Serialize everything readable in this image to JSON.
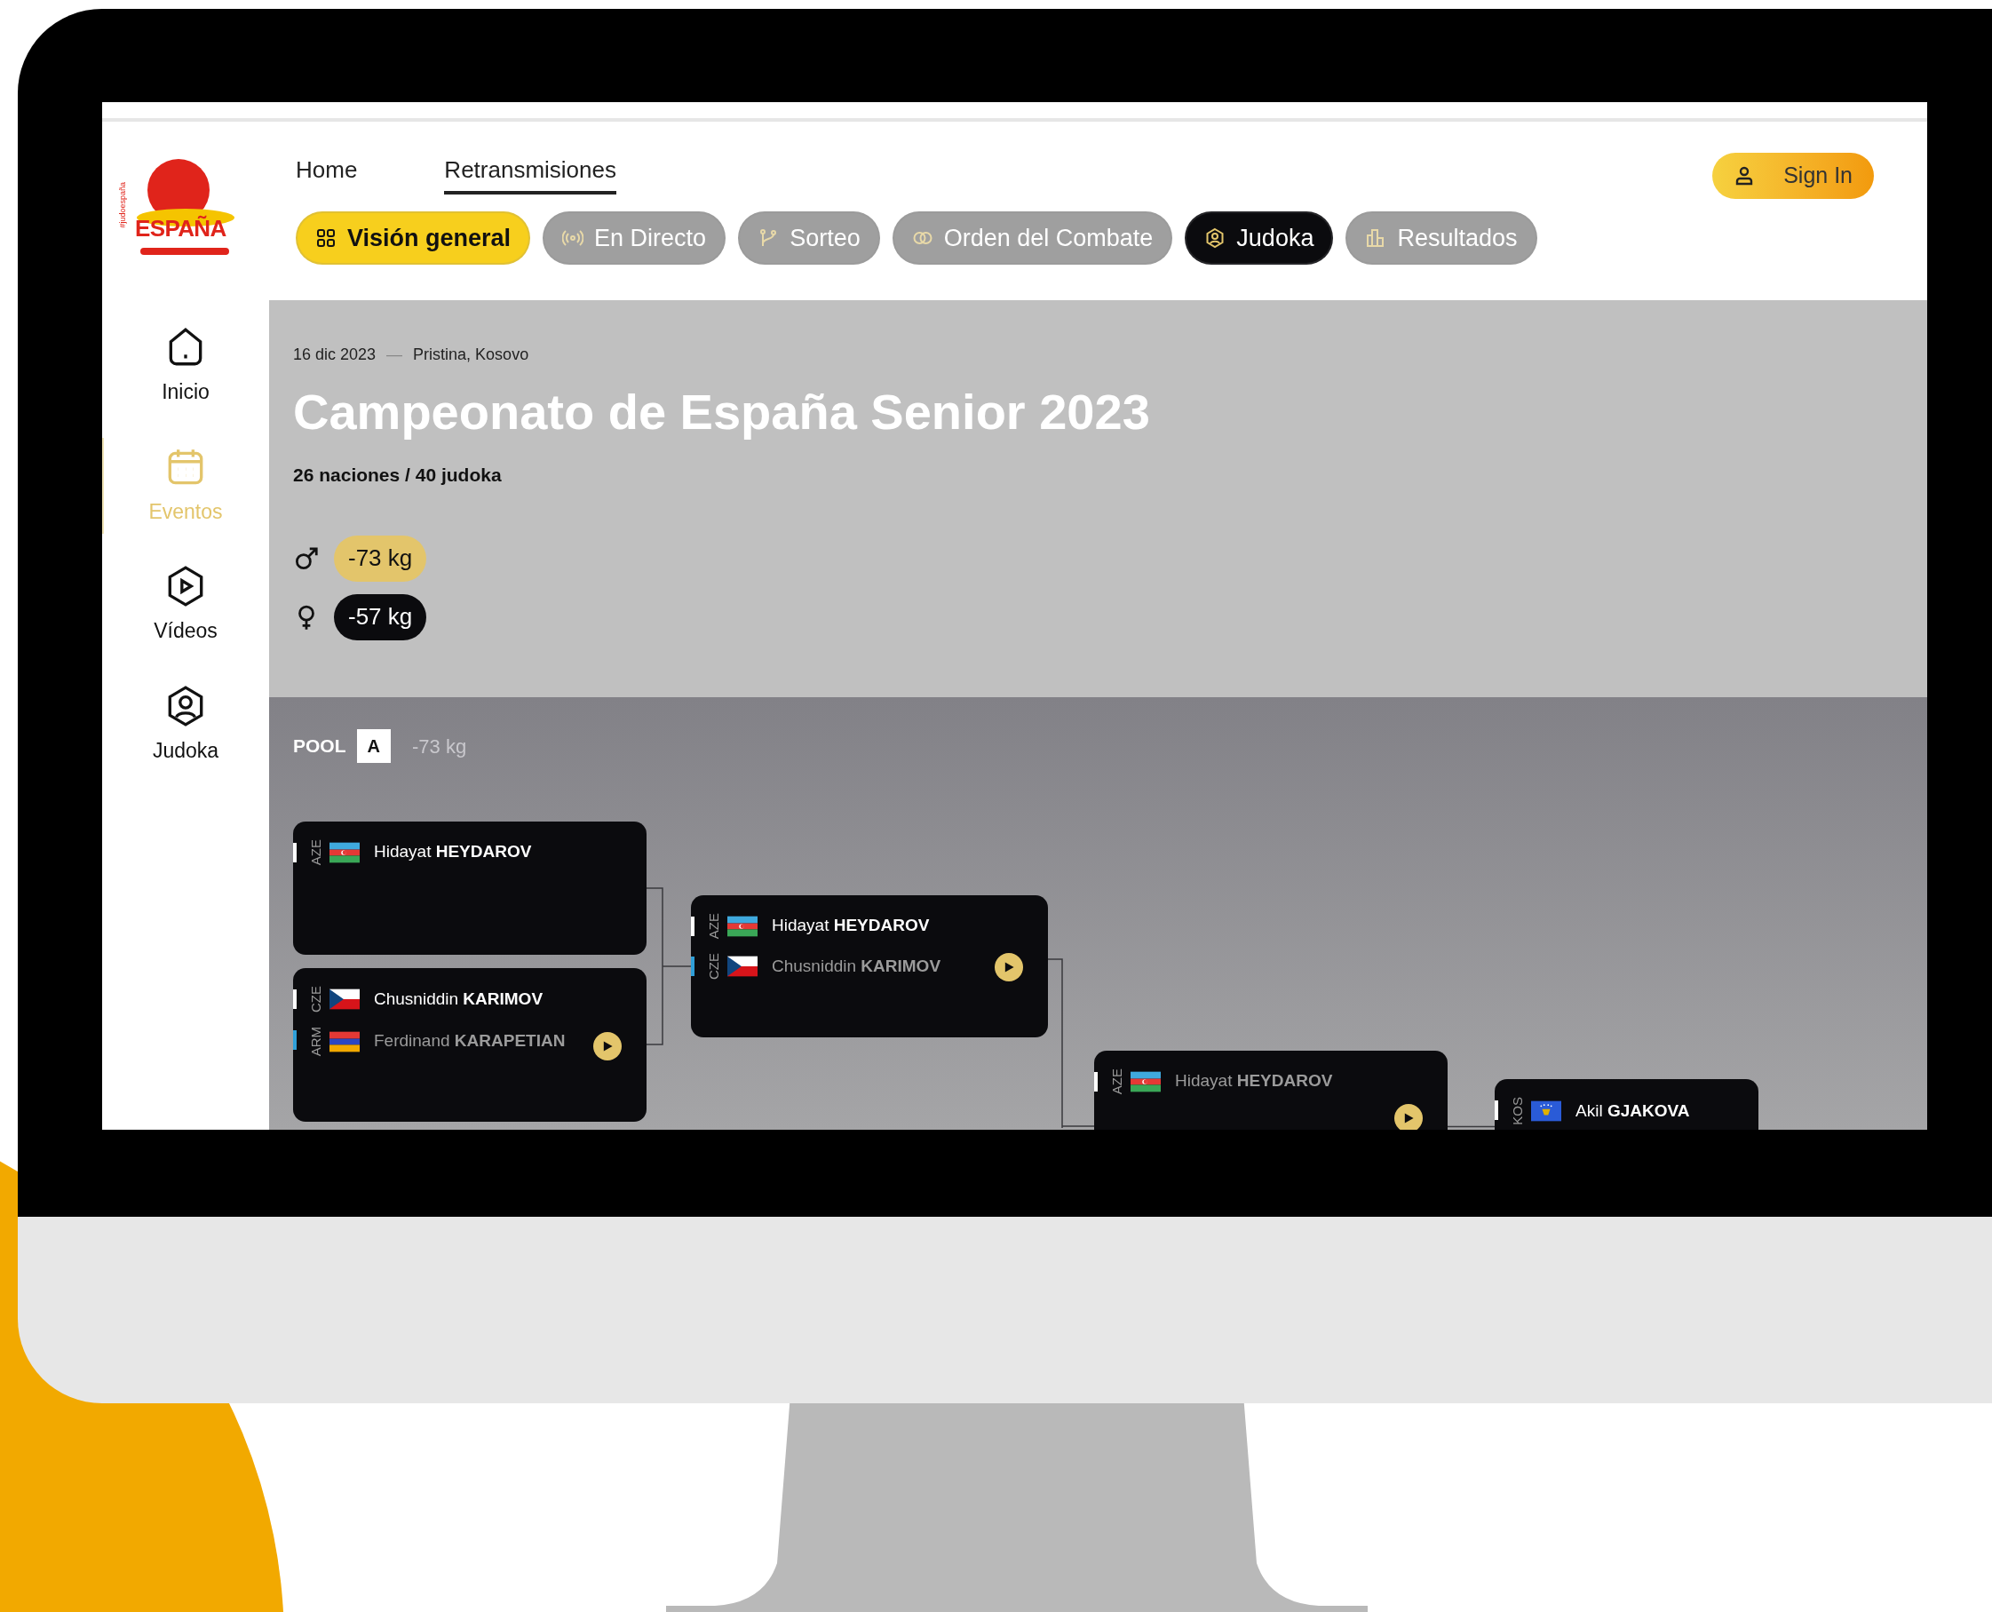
{
  "logo": {
    "name": "ESPAÑA",
    "tagline": "#judoespaña"
  },
  "nav": [
    {
      "label": "Home",
      "selected": false
    },
    {
      "label": "Retransmisiones",
      "selected": true
    }
  ],
  "sign_in": {
    "label": "Sign In"
  },
  "tabs": [
    {
      "label": "Visión general",
      "kind": "grid",
      "selected": true,
      "dark": false
    },
    {
      "label": "En Directo",
      "kind": "live",
      "selected": false,
      "dark": false
    },
    {
      "label": "Sorteo",
      "kind": "branch",
      "selected": false,
      "dark": false
    },
    {
      "label": "Orden del Combate",
      "kind": "rings",
      "selected": false,
      "dark": false
    },
    {
      "label": "Judoka",
      "kind": "person",
      "selected": false,
      "dark": true
    },
    {
      "label": "Resultados",
      "kind": "chart",
      "selected": false,
      "dark": false
    }
  ],
  "sidebar": {
    "items": [
      {
        "label": "Inicio",
        "kind": "home",
        "selected": false
      },
      {
        "label": "Eventos",
        "kind": "calendar",
        "selected": true
      },
      {
        "label": "Vídeos",
        "kind": "play",
        "selected": false
      },
      {
        "label": "Judoka",
        "kind": "person",
        "selected": false
      }
    ]
  },
  "event": {
    "date": "16 dic 2023",
    "separator": "—",
    "location": "Pristina, Kosovo",
    "title": "Campeonato de España Senior 2023",
    "stats": "26 naciones / 40 judoka",
    "categories": [
      {
        "kind": "male",
        "label": "-73 kg",
        "selected": true
      },
      {
        "kind": "female",
        "label": "-57 kg",
        "selected": false
      }
    ]
  },
  "pool": {
    "label": "POOL",
    "letter": "A",
    "category": "-73 kg"
  },
  "bracket": {
    "matches": [
      {
        "has_video": false,
        "competitors": [
          {
            "country": "AZE",
            "kind": "aze",
            "name": "Hidayat **HEYDAROV**",
            "winner": true
          }
        ]
      },
      {
        "has_video": true,
        "competitors": [
          {
            "country": "CZE",
            "kind": "cze",
            "name": "Chusniddin **KARIMOV**",
            "winner": true
          },
          {
            "country": "ARM",
            "kind": "arm",
            "name": "Ferdinand **KARAPETIAN**",
            "winner": false
          }
        ]
      },
      {
        "has_video": true,
        "competitors": [
          {
            "country": "AZE",
            "kind": "aze",
            "name": "Hidayat **HEYDAROV**",
            "winner": true
          },
          {
            "country": "CZE",
            "kind": "cze",
            "name": "Chusniddin **KARIMOV**",
            "winner": false
          }
        ]
      },
      {
        "has_video": true,
        "competitors": [
          {
            "country": "AZE",
            "kind": "aze",
            "name": "Hidayat **HEYDAROV**",
            "winner": false
          }
        ]
      },
      {
        "has_video": false,
        "competitors": [
          {
            "country": "KOS",
            "kind": "kos",
            "name": "Akil **GJAKOVA**",
            "winner": true
          }
        ]
      }
    ]
  }
}
